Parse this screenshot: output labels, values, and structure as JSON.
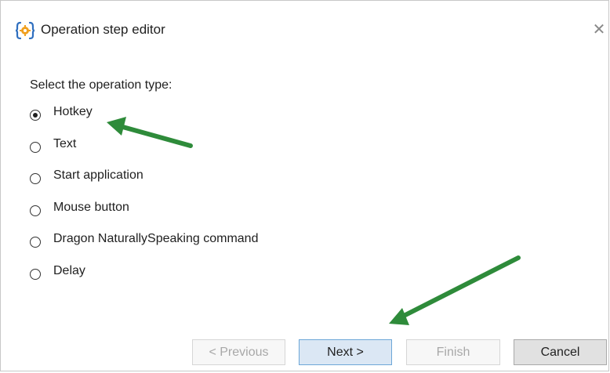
{
  "window": {
    "title": "Operation step editor",
    "icon": "operation-step-app-icon",
    "close_glyph": "✕"
  },
  "content": {
    "prompt": "Select the operation type:",
    "options": [
      {
        "label": "Hotkey",
        "selected": true
      },
      {
        "label": "Text",
        "selected": false
      },
      {
        "label": "Start application",
        "selected": false
      },
      {
        "label": "Mouse button",
        "selected": false
      },
      {
        "label": "Dragon NaturallySpeaking command",
        "selected": false
      },
      {
        "label": "Delay",
        "selected": false
      }
    ]
  },
  "buttons": {
    "previous": "< Previous",
    "next": "Next >",
    "finish": "Finish",
    "cancel": "Cancel"
  },
  "annotations": {
    "arrow_color": "#2e8b3a",
    "arrows": [
      "pointer-to-hotkey-option",
      "pointer-to-next-button"
    ]
  },
  "colors": {
    "accent_border": "#6da7d8",
    "accent_fill": "#dbe7f4"
  }
}
